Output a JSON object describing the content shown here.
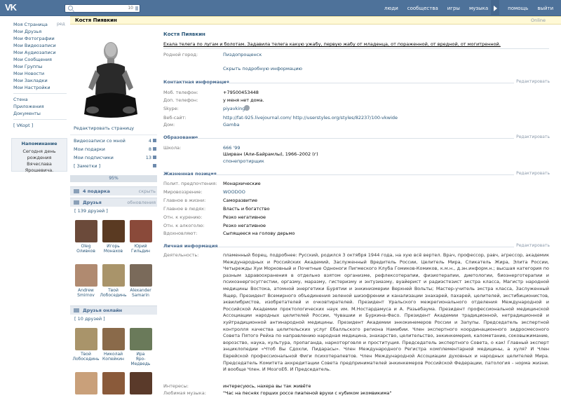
{
  "topbar": {
    "logo": "VK",
    "search_count": "10",
    "nav": [
      "люди",
      "сообщества",
      "игры",
      "музыка",
      "помощь",
      "выйти"
    ]
  },
  "leftnav": {
    "edit": "ред",
    "items": [
      "Моя Страница",
      "Мои Друзья",
      "Мои Фотографии",
      "Мои Видеозаписи",
      "Мои Аудиозаписи",
      "Мои Сообщения",
      "Мои Группы",
      "Мои Новости",
      "Мои Закладки",
      "Мои Настройки"
    ],
    "items2": [
      "Стена",
      "Приложения",
      "Документы"
    ],
    "vkopt": "[ VKopt ]"
  },
  "reminder": {
    "title": "Напоминание",
    "text": "Сегодня день рождения Вячеслава Ярошевича."
  },
  "profile_header": {
    "name": "Костя Пиявкин",
    "status": "Online"
  },
  "profile": {
    "name": "Костя Пиявкин",
    "status_text": "Ехала телега по лугам и болотам. Задавила телега какую ужабу, первую жабу от младенца, от пораженной, от вредной, от могитренной.",
    "hometown_label": "Родной город:",
    "hometown": "Пиздопрощенск",
    "hide_info": "Скрыть подробную информацию",
    "edit": "Редактировать",
    "contact": {
      "title": "Контактная информация",
      "rows": [
        [
          "Моб. телефон:",
          "+79500453448"
        ],
        [
          "Доп. телефон:",
          "у меня нет дома."
        ],
        [
          "Skype:",
          "piyavking"
        ],
        [
          "Веб-сайт:",
          "http://fat-925.livejournal.com/ http://userstyles.org/styles/82237/100-vkwide"
        ],
        [
          "Дом:",
          "Gamba"
        ]
      ]
    },
    "education": {
      "title": "Образование",
      "label": "Школа:",
      "school": "666 '99",
      "school2": "Ширван (Али-Байрамлы), 1966–2002 (г)",
      "school3": "спонепротирщик"
    },
    "life": {
      "title": "Жизненная позиция",
      "rows": [
        [
          "Полит. предпочтения:",
          "Монархические"
        ],
        [
          "Мировоззрение:",
          "WOODOO"
        ],
        [
          "Главное в жизни:",
          "Саморазвитие"
        ],
        [
          "Главное в людях:",
          "Власть и богатство"
        ],
        [
          "Отн. к курению:",
          "Резко негативное"
        ],
        [
          "Отн. к алкоголю:",
          "Резко негативное"
        ],
        [
          "Вдохновляют:",
          "Сыпящееся на голову дерьмо"
        ]
      ]
    },
    "personal": {
      "title": "Личная информация",
      "activity_label": "Деятельность:",
      "activity": "пламенный борец, подробнее: Русский, родился 3 октября 1944 года, на хую всё вертел. Врач, профессор, равч, агрессор, академик Международных и Российских Академий, Заслуженный Вредитель России, Целитель Мира, Спикатель Жира, Элита России, Четырежды Хуи Морковный и Почетные Одноноги Пигмеского Клуба Гомиков-Комиков, к.м.н., д.эн.информ.н.; высшая категория по разным здравоохранения в отдельно взятом организме, рефлексотерапии, физиотерапии, диетологии, биоэнерготерапии и психоэнергосуггестии, оргазму, маразму, гистеризму и энтузиазму, вуайерист и радиэстезист экстра класса, Магистр народной медицины Востока, атомной энергетики Бурятии и энкинизмерии Верхней Вольты; Мастер-учитель экстра класса, Заслуженный Ящер, Президент Всемирного объединения зеленой шизофрении и канализации знахарей, пахарей, целителей, экстибиционистов, эквилибристов, изобретателей и очковтирателей. Президент Уральского межрегионального отделения Международной и Российской Академии проктологических наук им. М.Ностардамуса и А. Разьебаума. Президент профессиональной медицинской Ассоциации народных целителей России, Чувашии и Буркина-Фасо. Президент Академии традиционной, нетрадиционной и хуйтрадиционной антинародной медицины. Президент Академии энкокинемеров России и Запупы. Председатель экспертной контролля качества целительских услуг Ебалльского региона Намибии. Член экспертного координационного зидросмесоного Совета Пятого Рейха по направлению народная медицина, знахарство, целительство, энкинкемерия, калометание, соковыжимание, ворозство, наука, культура, пропаганда, наркоторговля и проституция. Председатель экспертного Совета, о как! Главный эксперт энциклопедии «Чтоб Вы Сдохли, Пидарасы». Член Международного Регистра комплементарной медицины, а хуля? И Член Еврейской профессиональной Фиги психотерапевтов. Член Международной Ассоциации духовных и народных целителей Мира. Председатель Комитета аккредитации Совета предпринимателей энкинкемеров Российской Федерации, патология - норма жизни. И вообще Член. И МозгоЕб. И Председатель.",
      "interests_label": "Интересы:",
      "interests": "интересуюсь, нахера вы так живёте",
      "music_label": "Любимая музыка:",
      "music": "\"Час на песнях горших россе пиапеной врухи с кубиком экомвикима\""
    }
  },
  "left": {
    "edit_page": "Редактировать страницу",
    "rows": [
      [
        "Видеозаписи со мной",
        "4"
      ],
      [
        "Мои подарки",
        "8"
      ],
      [
        "Мои подписчики",
        "13"
      ],
      [
        "[ Заметки ]",
        ""
      ]
    ],
    "rating": "95%",
    "gifts": "4 подарка",
    "hide": "скрыть",
    "friends_title": "Друзья",
    "updates": "обновления",
    "friends_count": "[ 139 друзей ]",
    "friends": [
      [
        "Oleg",
        "Оливков"
      ],
      [
        "Игорь",
        "Монахов"
      ],
      [
        "Юрий",
        "Гильдин"
      ],
      [
        "Andrew",
        "Smirnov"
      ],
      [
        "Твой",
        "Лобосединь"
      ],
      [
        "Alexander",
        "Samarin"
      ]
    ],
    "online_title": "Друзья онлайн",
    "online_count": "[ 10 друзей ]",
    "online": [
      [
        "Твой",
        "Лобосединь"
      ],
      [
        "Николай",
        "Копейкин"
      ],
      [
        "Ира",
        "Яро-Медведь"
      ],
      [
        "",
        ""
      ],
      [
        "",
        ""
      ],
      [
        "",
        ""
      ]
    ]
  }
}
